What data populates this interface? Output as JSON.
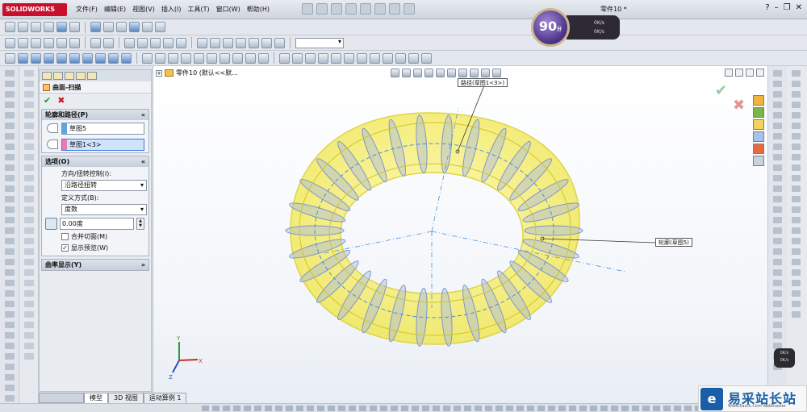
{
  "app": {
    "name": "SOLIDWORKS",
    "document_title": "零件10 *"
  },
  "menu": [
    "文件(F)",
    "编辑(E)",
    "视图(V)",
    "插入(I)",
    "工具(T)",
    "窗口(W)",
    "帮助(H)"
  ],
  "window_controls": [
    "?",
    "–",
    "❐",
    "✕"
  ],
  "property_manager": {
    "feature_title": "曲面-扫描",
    "ok_label": "✔",
    "cancel_label": "✖",
    "profile_group": {
      "title": "轮廓和路径(P)",
      "profile": "草图5",
      "path": "草图1<3>",
      "profile_color": "#5ba7e6",
      "path_color": "#ec7ab5"
    },
    "options_group": {
      "title": "选项(O)",
      "orientation_label": "方向/扭转控制(I):",
      "orientation_value": "沿路径扭转",
      "define_label": "定义方式(B):",
      "define_value": "度数",
      "twist_value": "0.00度",
      "merge_faces_label": "合并切面(M)",
      "merge_faces_checked": false,
      "show_preview_label": "显示预览(W)",
      "show_preview_checked": true
    },
    "curvature_group": {
      "title": "曲率显示(Y)"
    },
    "collapse_icon": "«",
    "expand_icon": "»"
  },
  "viewport": {
    "breadcrumb": "零件10  (默认<<默...",
    "path_callout": "路径(草图1<3>)",
    "profile_callout": "轮廓(草图5)",
    "triad": {
      "x": "X",
      "y": "Y",
      "z": "Z"
    }
  },
  "bottom_tabs": [
    "模型",
    "3D 视图",
    "运动算例 1"
  ],
  "speed_widget": {
    "value": "90",
    "unit": "分",
    "up": "0K/s",
    "down": "0K/s"
  },
  "mini_speed": {
    "up": "0K/s",
    "down": "0K/s"
  },
  "watermark": {
    "name": "易采站长站",
    "url": "Www.Easck.Com  Webmaster"
  },
  "colors": {
    "torus_fill": "#f4f06a",
    "torus_edge": "#d7cf2a",
    "ribs": "#8ea3d6",
    "accent": "#3b7ddd"
  }
}
